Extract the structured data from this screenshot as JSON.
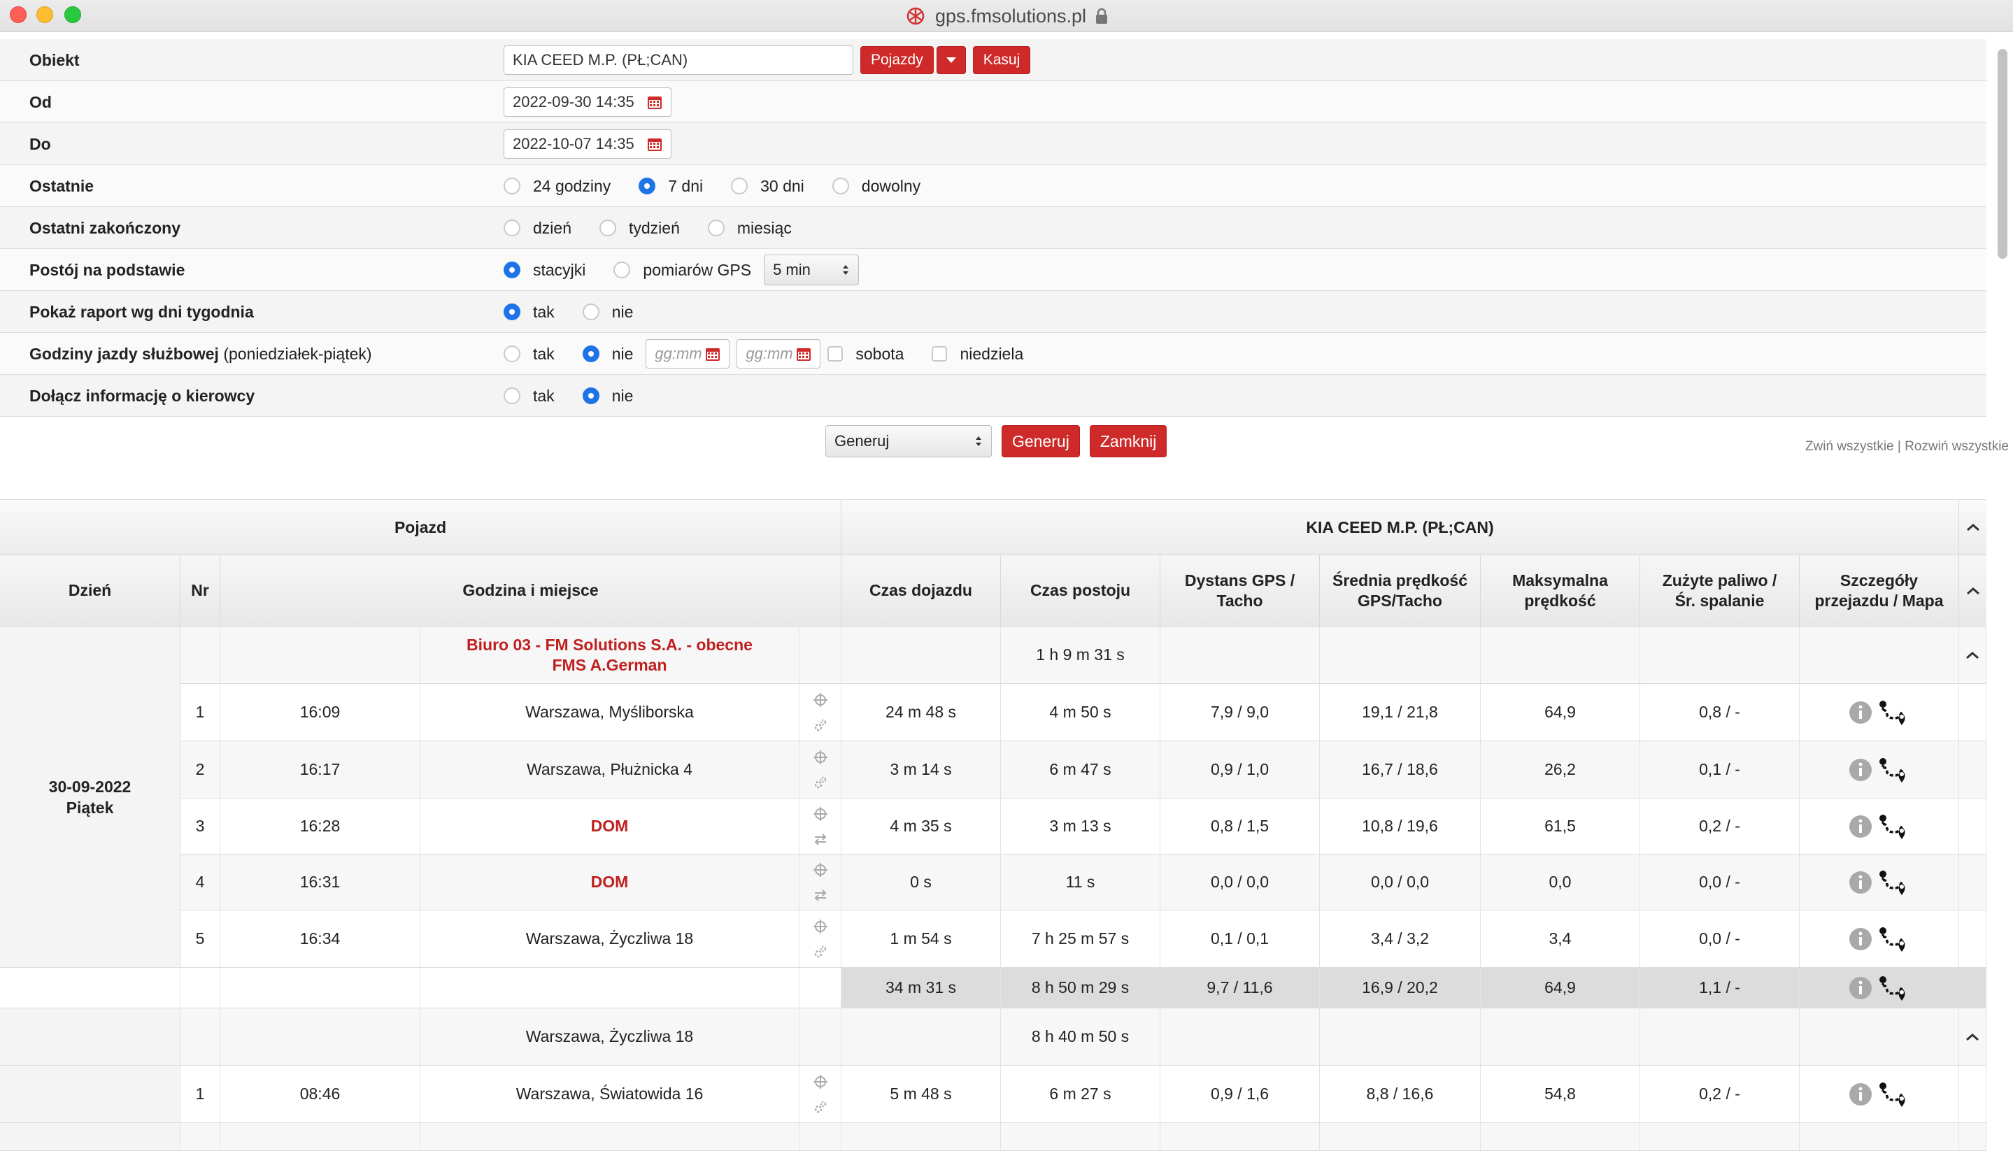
{
  "window": {
    "url": "gps.fmsolutions.pl"
  },
  "form": {
    "obiekt_label": "Obiekt",
    "obiekt_value": "KIA CEED M.P. (PŁ;CAN)",
    "pojazdy_button": "Pojazdy",
    "kasuj_button": "Kasuj",
    "od_label": "Od",
    "od_value": "2022-09-30 14:35",
    "do_label": "Do",
    "do_value": "2022-10-07 14:35",
    "ostatnie_label": "Ostatnie",
    "ostatnie_options": [
      "24 godziny",
      "7 dni",
      "30 dni",
      "dowolny"
    ],
    "ostatnie_selected": "7 dni",
    "ostatni_zakonczony_label": "Ostatni zakończony",
    "ostatni_zakonczony_options": [
      "dzień",
      "tydzień",
      "miesiąc"
    ],
    "postoj_label": "Postój na podstawie",
    "postoj_options": [
      "stacyjki",
      "pomiarów GPS"
    ],
    "postoj_selected": "stacyjki",
    "postoj_interval": "5 min",
    "raport_dni_label": "Pokaż raport wg dni tygodnia",
    "raport_dni_options": [
      "tak",
      "nie"
    ],
    "raport_dni_selected": "tak",
    "godziny_label": "Godziny jazdy służbowej",
    "godziny_sub": "(poniedziałek-piątek)",
    "godziny_options": [
      "tak",
      "nie"
    ],
    "godziny_selected": "nie",
    "time_placeholder": "gg:mm",
    "sobota": "sobota",
    "niedziela": "niedziela",
    "kierowca_label": "Dołącz informację o kierowcy",
    "kierowca_options": [
      "tak",
      "nie"
    ],
    "kierowca_selected": "nie",
    "generate_select": "Generuj",
    "generate_button": "Generuj",
    "close_button": "Zamknij",
    "collapse_all": "Zwiń wszystkie",
    "expand_all": "Rozwiń wszystkie"
  },
  "table": {
    "group_header_vehicle": "Pojazd",
    "group_header_name": "KIA CEED M.P. (PŁ;CAN)",
    "columns": {
      "day": "Dzień",
      "nr": "Nr",
      "time_place": "Godzina i miejsce",
      "drive_time": "Czas dojazdu",
      "stop_time": "Czas postoju",
      "distance": "Dystans GPS / Tacho",
      "avg_speed": "Średnia prędkość GPS/Tacho",
      "max_speed": "Maksymalna prędkość",
      "fuel": "Zużyte paliwo / Śr. spalanie",
      "details": "Szczegóły przejazdu / Mapa"
    },
    "day1": {
      "date": "30-09-2022",
      "weekday": "Piątek",
      "start_place_line1": "Biuro 03 - FM Solutions S.A. - obecne",
      "start_place_line2": "FMS A.German",
      "start_stop": "1 h 9 m 31 s",
      "rows": [
        {
          "nr": "1",
          "time": "16:09",
          "place": "Warszawa, Myśliborska",
          "drive": "24 m 48 s",
          "stop": "4 m 50 s",
          "dist": "7,9 /  9,0",
          "avg": "19,1 /  21,8",
          "max": "64,9",
          "fuel": "0,8 /  -",
          "red": false
        },
        {
          "nr": "2",
          "time": "16:17",
          "place": "Warszawa, Płużnicka 4",
          "drive": "3 m 14 s",
          "stop": "6 m 47 s",
          "dist": "0,9 /  1,0",
          "avg": "16,7 /  18,6",
          "max": "26,2",
          "fuel": "0,1 /  -",
          "red": false
        },
        {
          "nr": "3",
          "time": "16:28",
          "place": "DOM",
          "drive": "4 m 35 s",
          "stop": "3 m 13 s",
          "dist": "0,8 /  1,5",
          "avg": "10,8 /  19,6",
          "max": "61,5",
          "fuel": "0,2 /  -",
          "red": true
        },
        {
          "nr": "4",
          "time": "16:31",
          "place": "DOM",
          "drive": "0 s",
          "stop": "11 s",
          "dist": "0,0 /  0,0",
          "avg": "0,0 /  0,0",
          "max": "0,0",
          "fuel": "0,0 /  -",
          "red": true
        },
        {
          "nr": "5",
          "time": "16:34",
          "place": "Warszawa, Życzliwa 18",
          "drive": "1 m 54 s",
          "stop": "7 h 25 m 57 s",
          "dist": "0,1 /  0,1",
          "avg": "3,4 /  3,2",
          "max": "3,4",
          "fuel": "0,0 /  -",
          "red": false
        }
      ],
      "summary": {
        "drive": "34 m 31 s",
        "stop": "8 h 50 m 29 s",
        "dist": "9,7 /  11,6",
        "avg": "16,9 /  20,2",
        "max": "64,9",
        "fuel": "1,1 /  -"
      }
    },
    "day2": {
      "start_place": "Warszawa, Życzliwa 18",
      "start_stop": "8 h 40 m 50 s",
      "rows": [
        {
          "nr": "1",
          "time": "08:46",
          "place": "Warszawa, Światowida 16",
          "drive": "5 m 48 s",
          "stop": "6 m 27 s",
          "dist": "0,9 /  1,6",
          "avg": "8,8 /  16,6",
          "max": "54,8",
          "fuel": "0,2 /  -",
          "red": false
        }
      ]
    }
  },
  "colors": {
    "accent_red": "#cf2a2a",
    "radio_blue": "#1e74e6",
    "place_red": "#c01f1f"
  },
  "icons": [
    "fms-logo-icon",
    "lock-icon",
    "calendar-icon",
    "crosshair-icon",
    "gear-icon",
    "swap-icon",
    "info-icon",
    "route-map-icon",
    "chevron-up-icon"
  ]
}
